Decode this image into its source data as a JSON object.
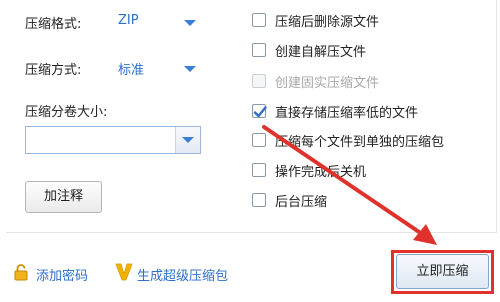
{
  "options": {
    "format_label": "压缩格式:",
    "format_value": "ZIP",
    "method_label": "压缩方式:",
    "method_value": "标准",
    "split_label": "压缩分卷大小:",
    "split_value": "",
    "comment_button": "加注释"
  },
  "checkboxes": [
    {
      "label": "压缩后删除源文件",
      "checked": false,
      "disabled": false
    },
    {
      "label": "创建自解压文件",
      "checked": false,
      "disabled": false
    },
    {
      "label": "创建固实压缩文件",
      "checked": false,
      "disabled": true
    },
    {
      "label": "直接存储压缩率低的文件",
      "checked": true,
      "disabled": false
    },
    {
      "label": "压缩每个文件到单独的压缩包",
      "checked": false,
      "disabled": false
    },
    {
      "label": "操作完成后关机",
      "checked": false,
      "disabled": false
    },
    {
      "label": "后台压缩",
      "checked": false,
      "disabled": false
    }
  ],
  "footer": {
    "password_link": "添加密码",
    "super_link": "生成超级压缩包",
    "compress_button": "立即压缩"
  },
  "colors": {
    "link": "#2f6fc8",
    "highlight": "#e0322c",
    "check": "#2f6fc8",
    "lock": "#e8a317",
    "v_logo": "#f0b400"
  }
}
